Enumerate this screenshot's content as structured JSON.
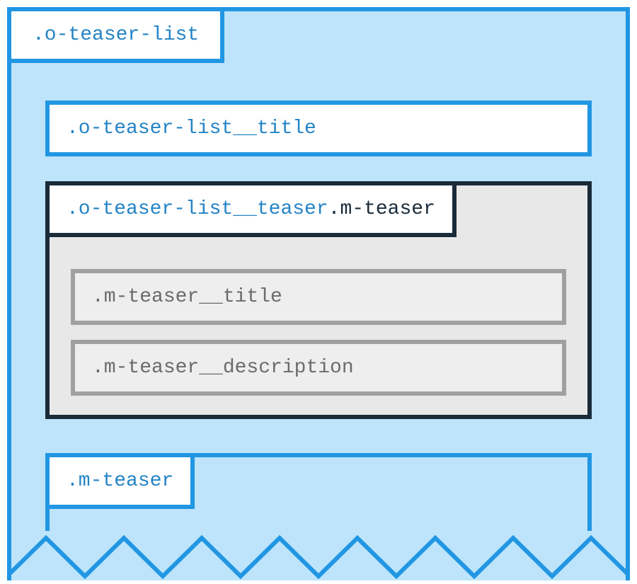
{
  "outer": {
    "label": ".o-teaser-list",
    "title_box": ".o-teaser-list__title"
  },
  "teaser": {
    "label_part1": ".o-teaser-list__teaser",
    "label_part2": ".m-teaser",
    "inner_title": ".m-teaser__title",
    "inner_description": ".m-teaser__description"
  },
  "second_teaser": {
    "label": ".m-teaser"
  },
  "colors": {
    "blue_border": "#2196e3",
    "blue_bg": "#bde4fa",
    "blue_text": "#2584c6",
    "dark_border": "#1a2b3a",
    "gray_bg": "#e8e8e8",
    "gray_border": "#a0a0a0",
    "gray_text": "#6b6b6b"
  }
}
